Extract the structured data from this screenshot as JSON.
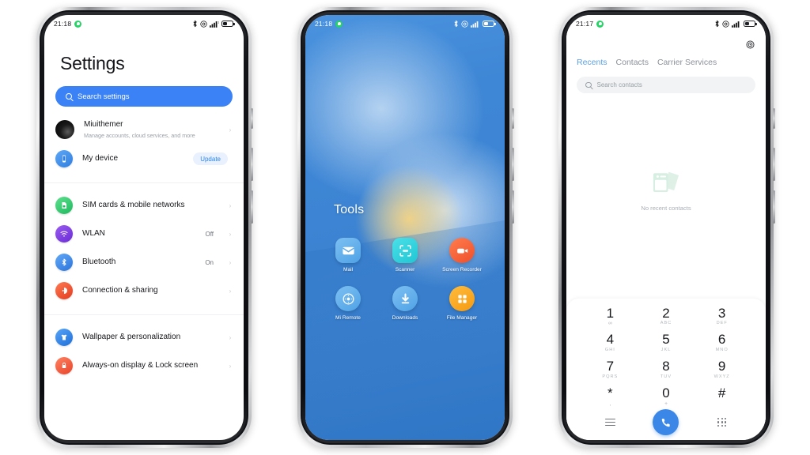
{
  "phones": [
    {
      "id": "settings-phone",
      "status_bar": {
        "time": "21:18",
        "icons": [
          "whatsapp-dot",
          "bluetooth-icon",
          "dnd-icon",
          "signal-icon",
          "battery-icon"
        ]
      },
      "screen": {
        "title": "Settings",
        "search": {
          "placeholder": "Search settings",
          "icon": "search-icon",
          "accent": "#3b82f6"
        },
        "groups": [
          {
            "items": [
              {
                "title": "Miuithemer",
                "subtitle": "Manage accounts, cloud services, and more",
                "icon": "avatar",
                "value": "",
                "badge": "",
                "chevron": true
              },
              {
                "title": "My device",
                "subtitle": "",
                "icon": "device-icon",
                "icon_color": "#3d8ff0",
                "value": "",
                "badge": "Update",
                "chevron": false
              }
            ]
          },
          {
            "items": [
              {
                "title": "SIM cards & mobile networks",
                "subtitle": "",
                "icon": "sim-card-icon",
                "icon_color": "#2ecc71",
                "value": "",
                "badge": "",
                "chevron": true
              },
              {
                "title": "WLAN",
                "subtitle": "",
                "icon": "wifi-icon",
                "icon_color": "#7b3fe4",
                "value": "Off",
                "badge": "",
                "chevron": true
              },
              {
                "title": "Bluetooth",
                "subtitle": "",
                "icon": "bluetooth-icon",
                "icon_color": "#3d8ff0",
                "value": "On",
                "badge": "",
                "chevron": true
              },
              {
                "title": "Connection & sharing",
                "subtitle": "",
                "icon": "connection-sharing-icon",
                "icon_color": "#f04b36",
                "value": "",
                "badge": "",
                "chevron": true
              }
            ]
          },
          {
            "items": [
              {
                "title": "Wallpaper & personalization",
                "subtitle": "",
                "icon": "tshirt-icon",
                "icon_color": "#2e86f0",
                "value": "",
                "badge": "",
                "chevron": true
              },
              {
                "title": "Always-on display & Lock screen",
                "subtitle": "",
                "icon": "lock-icon",
                "icon_color": "#f05a43",
                "value": "",
                "badge": "",
                "chevron": true
              }
            ]
          }
        ]
      }
    },
    {
      "id": "home-phone",
      "status_bar": {
        "time": "21:18",
        "icons": [
          "whatsapp-dot",
          "bluetooth-icon",
          "dnd-icon",
          "signal-icon",
          "battery-icon"
        ]
      },
      "screen": {
        "folder_title": "Tools",
        "wallpaper_colors": [
          "#4b93de",
          "#3a7fcd",
          "#2f76c6",
          "#ffd678",
          "#e2effb"
        ],
        "apps": [
          {
            "name": "Mail",
            "icon": "mail-icon",
            "color": "#63b0ec"
          },
          {
            "name": "Scanner",
            "icon": "scanner-icon",
            "color": "#2fd0dd"
          },
          {
            "name": "Screen Recorder",
            "icon": "screen-recorder-icon",
            "color": "#f4653c"
          },
          {
            "name": "Mi Remote",
            "icon": "remote-icon",
            "color": "#63b0ec"
          },
          {
            "name": "Downloads",
            "icon": "download-icon",
            "color": "#63b0ec"
          },
          {
            "name": "File Manager",
            "icon": "file-manager-icon",
            "color": "#f6a623"
          }
        ]
      }
    },
    {
      "id": "dialer-phone",
      "status_bar": {
        "time": "21:17",
        "icons": [
          "whatsapp-dot",
          "bluetooth-icon",
          "dnd-icon",
          "signal-icon",
          "battery-icon"
        ]
      },
      "screen": {
        "settings_icon": "gear-icon",
        "tabs": [
          {
            "label": "Recents",
            "active": true
          },
          {
            "label": "Contacts",
            "active": false
          },
          {
            "label": "Carrier Services",
            "active": false
          }
        ],
        "search": {
          "placeholder": "Search contacts",
          "icon": "search-icon"
        },
        "empty_state": {
          "text": "No recent contacts",
          "icon": "empty-contacts-icon",
          "color": "#d8efe1"
        },
        "keypad": [
          {
            "digit": "1",
            "letters": "∞"
          },
          {
            "digit": "2",
            "letters": "ABC"
          },
          {
            "digit": "3",
            "letters": "DEF"
          },
          {
            "digit": "4",
            "letters": "GHI"
          },
          {
            "digit": "5",
            "letters": "JKL"
          },
          {
            "digit": "6",
            "letters": "MNO"
          },
          {
            "digit": "7",
            "letters": "PQRS"
          },
          {
            "digit": "8",
            "letters": "TUV"
          },
          {
            "digit": "9",
            "letters": "WXYZ"
          },
          {
            "digit": "*",
            "letters": ","
          },
          {
            "digit": "0",
            "letters": "+"
          },
          {
            "digit": "#",
            "letters": ""
          }
        ],
        "actions": {
          "menu": "menu-icon",
          "call": "call-icon",
          "keypad_toggle": "keypad-icon",
          "call_color": "#3b87e8"
        }
      }
    }
  ]
}
